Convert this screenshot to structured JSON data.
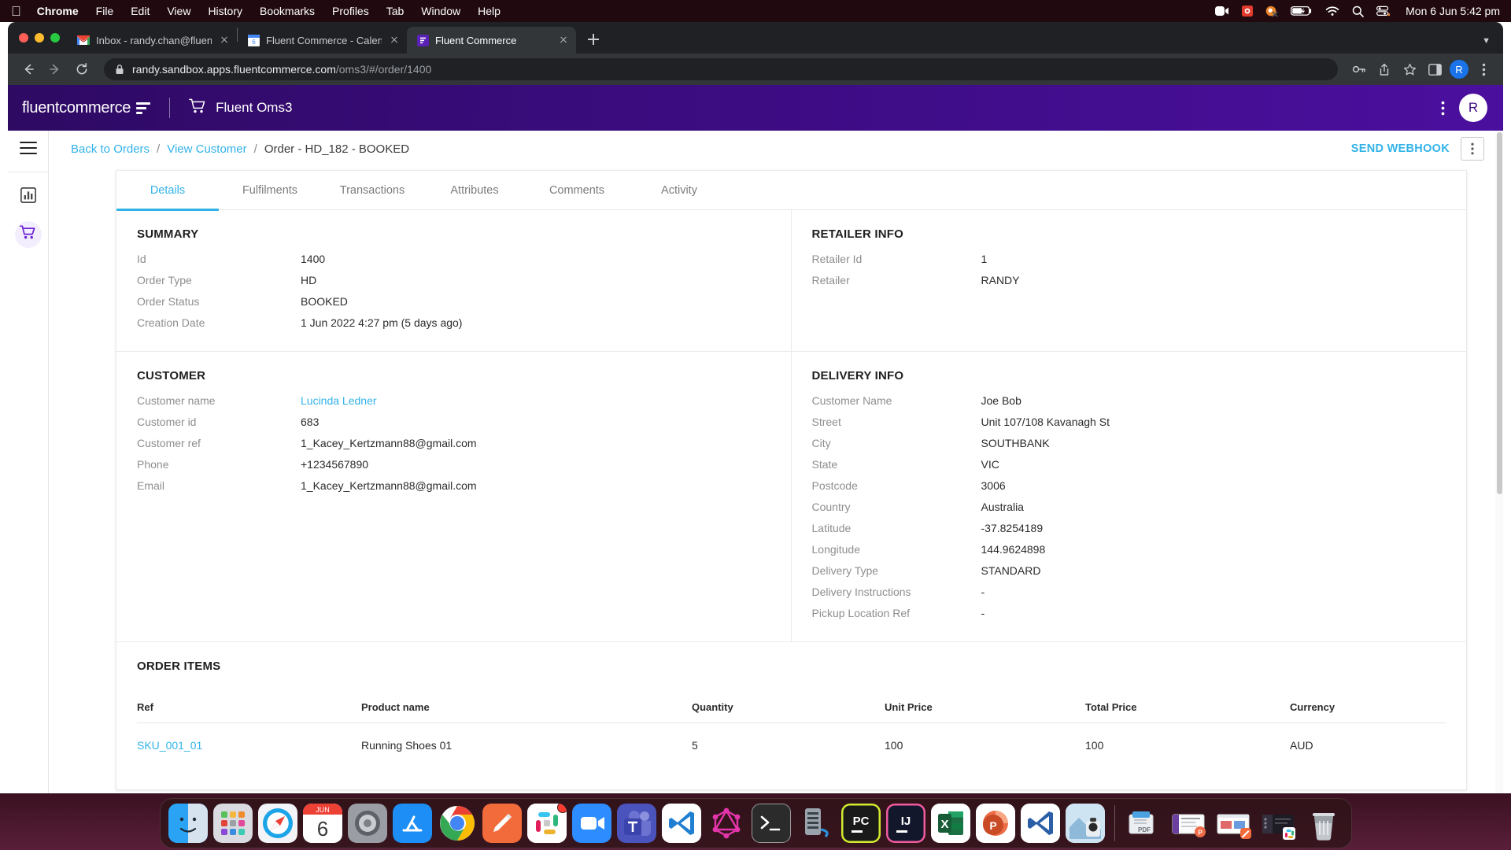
{
  "menubar": {
    "app_name": "Chrome",
    "items": [
      "File",
      "Edit",
      "View",
      "History",
      "Bookmarks",
      "Profiles",
      "Tab",
      "Window",
      "Help"
    ],
    "clock": "Mon 6 Jun  5:42 pm",
    "status_icons": [
      "zoom-icon",
      "red-app-icon",
      "orange-app-icon",
      "battery-charging-icon",
      "wifi-icon",
      "spotlight-search-icon",
      "control-center-icon"
    ]
  },
  "browser": {
    "tabs": [
      {
        "title": "Inbox - randy.chan@fluentcom",
        "favicon": "gmail-icon",
        "active": false
      },
      {
        "title": "Fluent Commerce - Calendar -",
        "favicon": "google-calendar-icon",
        "active": false
      },
      {
        "title": "Fluent Commerce",
        "favicon": "fluent-commerce-icon",
        "active": true
      }
    ],
    "new_tab_label": "+",
    "url_domain": "randy.sandbox.apps.fluentcommerce.com",
    "url_path": "/oms3/#/order/1400",
    "profile_initial": "R",
    "toolbar_icons": [
      "back-icon",
      "forward-icon",
      "reload-icon",
      "lock-icon",
      "password-key-icon",
      "share-icon",
      "bookmark-star-icon",
      "side-panel-icon",
      "chrome-menu-icon"
    ]
  },
  "app": {
    "logo_prefix": "fluent",
    "logo_suffix": "commerce",
    "product_name": "Fluent Oms3",
    "header_avatar": "R"
  },
  "rail": {
    "items": [
      {
        "name": "menu-toggle",
        "icon": "hamburger-icon"
      },
      {
        "name": "reports",
        "icon": "bar-chart-icon",
        "active": false
      },
      {
        "name": "orders",
        "icon": "shopping-cart-icon",
        "active": true
      }
    ]
  },
  "breadcrumb": {
    "back_to_orders": "Back to Orders",
    "view_customer": "View Customer",
    "current": "Order - HD_182 - BOOKED",
    "separator": "/"
  },
  "actions": {
    "send_webhook": "SEND WEBHOOK",
    "kebab": "⋮"
  },
  "tabs": [
    {
      "label": "Details",
      "active": true
    },
    {
      "label": "Fulfilments",
      "active": false
    },
    {
      "label": "Transactions",
      "active": false
    },
    {
      "label": "Attributes",
      "active": false
    },
    {
      "label": "Comments",
      "active": false
    },
    {
      "label": "Activity",
      "active": false
    }
  ],
  "summary": {
    "title": "SUMMARY",
    "rows": [
      {
        "label": "Id",
        "value": "1400"
      },
      {
        "label": "Order Type",
        "value": "HD"
      },
      {
        "label": "Order Status",
        "value": "BOOKED"
      },
      {
        "label": "Creation Date",
        "value": "1 Jun 2022 4:27 pm (5 days ago)"
      }
    ]
  },
  "retailer_info": {
    "title": "RETAILER INFO",
    "rows": [
      {
        "label": "Retailer Id",
        "value": "1"
      },
      {
        "label": "Retailer",
        "value": "RANDY"
      }
    ]
  },
  "customer": {
    "title": "CUSTOMER",
    "rows": [
      {
        "label": "Customer name",
        "value": "Lucinda Ledner",
        "link": true
      },
      {
        "label": "Customer id",
        "value": "683"
      },
      {
        "label": "Customer ref",
        "value": "1_Kacey_Kertzmann88@gmail.com"
      },
      {
        "label": "Phone",
        "value": "+1234567890"
      },
      {
        "label": "Email",
        "value": "1_Kacey_Kertzmann88@gmail.com"
      }
    ]
  },
  "delivery_info": {
    "title": "DELIVERY INFO",
    "rows": [
      {
        "label": "Customer Name",
        "value": "Joe Bob"
      },
      {
        "label": "Street",
        "value": "Unit 107/108 Kavanagh St"
      },
      {
        "label": "City",
        "value": "SOUTHBANK"
      },
      {
        "label": "State",
        "value": "VIC"
      },
      {
        "label": "Postcode",
        "value": "3006"
      },
      {
        "label": "Country",
        "value": "Australia"
      },
      {
        "label": "Latitude",
        "value": "-37.8254189"
      },
      {
        "label": "Longitude",
        "value": "144.9624898"
      },
      {
        "label": "Delivery Type",
        "value": "STANDARD"
      },
      {
        "label": "Delivery Instructions",
        "value": "-"
      },
      {
        "label": "Pickup Location Ref",
        "value": "-"
      }
    ]
  },
  "order_items": {
    "title": "ORDER ITEMS",
    "columns": [
      "Ref",
      "Product name",
      "Quantity",
      "Unit Price",
      "Total Price",
      "Currency"
    ],
    "rows": [
      {
        "ref": "SKU_001_01",
        "product_name": "Running Shoes 01",
        "quantity": "5",
        "unit_price": "100",
        "total_price": "100",
        "currency": "AUD"
      }
    ]
  },
  "dock": {
    "apps": [
      {
        "name": "finder",
        "running": true
      },
      {
        "name": "launchpad",
        "running": false
      },
      {
        "name": "safari",
        "running": false
      },
      {
        "name": "calendar",
        "running": false,
        "month": "JUN",
        "day": "6"
      },
      {
        "name": "system-preferences",
        "running": false
      },
      {
        "name": "app-store",
        "running": false
      },
      {
        "name": "google-chrome",
        "running": true
      },
      {
        "name": "postman",
        "running": true
      },
      {
        "name": "slack",
        "running": true,
        "badge": true
      },
      {
        "name": "zoom",
        "running": true
      },
      {
        "name": "microsoft-teams",
        "running": false
      },
      {
        "name": "visual-studio-code",
        "running": true
      },
      {
        "name": "graphql-playground",
        "running": false
      },
      {
        "name": "terminal",
        "running": false
      },
      {
        "name": "server",
        "running": false
      },
      {
        "name": "pycharm",
        "running": false
      },
      {
        "name": "intellij-idea",
        "running": false
      },
      {
        "name": "microsoft-excel",
        "running": false
      },
      {
        "name": "microsoft-powerpoint",
        "running": true
      },
      {
        "name": "vscode-insiders",
        "running": false
      },
      {
        "name": "preview",
        "running": false
      }
    ],
    "minimized": [
      {
        "name": "pdf-folder-stack"
      },
      {
        "name": "powerpoint-window"
      },
      {
        "name": "postman-window"
      },
      {
        "name": "slack-window"
      }
    ],
    "trash": {
      "name": "trash"
    }
  },
  "colors": {
    "accent_blue": "#32b3e8",
    "brand_purple": "#3b0c80",
    "chrome_dark": "#323639",
    "menubar": "#200a10"
  }
}
